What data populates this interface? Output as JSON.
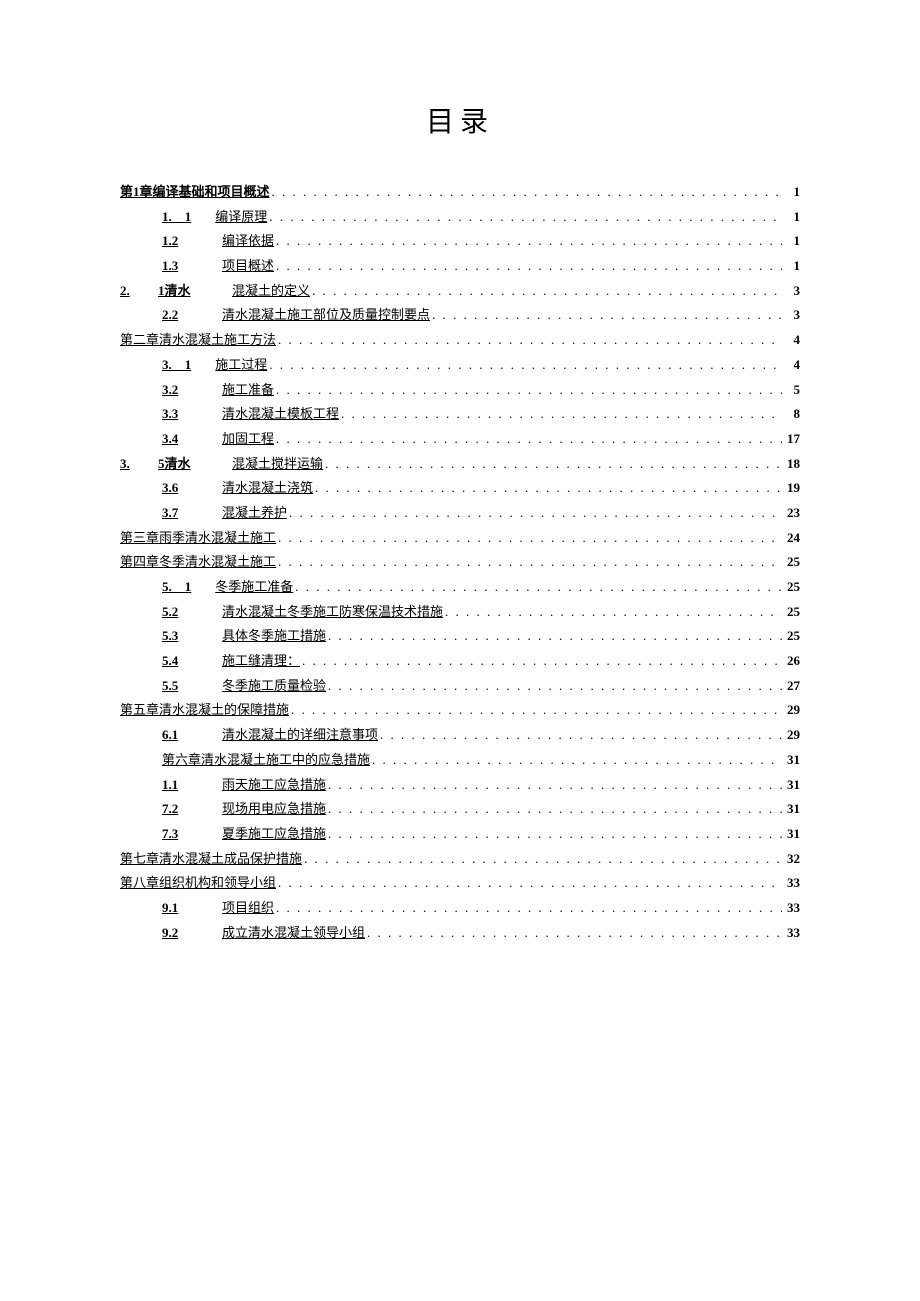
{
  "title": "目录",
  "entries": [
    {
      "level": 0,
      "type": "chapter-bold",
      "label": "第1章编译基础和项目概述",
      "page": "1"
    },
    {
      "level": 1,
      "type": "sub-split",
      "num": "1.　1",
      "label": "编译原理",
      "page": "1"
    },
    {
      "level": 1,
      "type": "sub",
      "num": "1.2",
      "label": "编译依据",
      "page": "1"
    },
    {
      "level": 1,
      "type": "sub",
      "num": "1.3",
      "label": "项目概述",
      "page": "1"
    },
    {
      "level": 0,
      "type": "prefix",
      "prefix": "2.",
      "num": "1清水",
      "label": "混凝土的定义",
      "page": "3"
    },
    {
      "level": 1,
      "type": "sub",
      "num": "2.2",
      "label": "清水混凝土施工部位及质量控制要点",
      "page": "3"
    },
    {
      "level": 0,
      "type": "chapter",
      "label": "第二章清水混凝土施工方法",
      "page": "4"
    },
    {
      "level": 1,
      "type": "sub-split",
      "num": "3.　1",
      "label": "施工过程",
      "page": "4"
    },
    {
      "level": 1,
      "type": "sub",
      "num": "3.2",
      "label": "施工准备",
      "page": "5"
    },
    {
      "level": 1,
      "type": "sub",
      "num": "3.3",
      "label": "清水混凝土模板工程",
      "page": "8"
    },
    {
      "level": 1,
      "type": "sub",
      "num": "3.4",
      "label": "加固工程",
      "page": "17"
    },
    {
      "level": 0,
      "type": "prefix",
      "prefix": "3.",
      "num": "5清水",
      "label": "混凝土搅拌运输",
      "page": "18"
    },
    {
      "level": 1,
      "type": "sub",
      "num": "3.6",
      "label": "清水混凝土浇筑",
      "page": "19"
    },
    {
      "level": 1,
      "type": "sub",
      "num": "3.7",
      "label": "混凝土养护",
      "page": "23"
    },
    {
      "level": 0,
      "type": "chapter",
      "label": "第三章雨季清水混凝土施工",
      "page": "24"
    },
    {
      "level": 0,
      "type": "chapter",
      "label": "第四章冬季清水混凝土施工",
      "page": "25"
    },
    {
      "level": 1,
      "type": "sub-split",
      "num": "5.　1",
      "label": "冬季施工准备",
      "page": "25"
    },
    {
      "level": 1,
      "type": "sub",
      "num": "5.2",
      "label": "清水混凝土冬季施工防寒保温技术措施",
      "page": "25"
    },
    {
      "level": 1,
      "type": "sub",
      "num": "5.3",
      "label": "具体冬季施工措施",
      "page": "25"
    },
    {
      "level": 1,
      "type": "sub",
      "num": "5.4",
      "label": "施工缝清理：",
      "page": "26"
    },
    {
      "level": 1,
      "type": "sub",
      "num": "5.5",
      "label": "冬季施工质量检验",
      "page": "27"
    },
    {
      "level": 0,
      "type": "chapter",
      "label": "第五章清水混凝土的保障措施",
      "page": "29"
    },
    {
      "level": 1,
      "type": "sub",
      "num": "6.1",
      "label": "清水混凝土的详细注意事项",
      "page": "29"
    },
    {
      "level": 1,
      "type": "chapter-indent",
      "label": "第六章清水混凝土施工中的应急措施",
      "page": "31"
    },
    {
      "level": 1,
      "type": "sub",
      "num": "1.1",
      "label": "雨天施工应急措施",
      "page": "31"
    },
    {
      "level": 1,
      "type": "sub",
      "num": "7.2",
      "label": "现场用电应急措施",
      "page": "31"
    },
    {
      "level": 1,
      "type": "sub",
      "num": "7.3",
      "label": "夏季施工应急措施",
      "page": "31"
    },
    {
      "level": 0,
      "type": "chapter",
      "label": "第七章清水混凝土成品保护措施",
      "page": "32"
    },
    {
      "level": 0,
      "type": "chapter",
      "label": "第八章组织机构和领导小组",
      "page": "33"
    },
    {
      "level": 1,
      "type": "sub",
      "num": "9.1",
      "label": "项目组织",
      "page": "33"
    },
    {
      "level": 1,
      "type": "sub",
      "num": "9.2",
      "label": "成立清水混凝土领导小组",
      "page": "33"
    }
  ]
}
